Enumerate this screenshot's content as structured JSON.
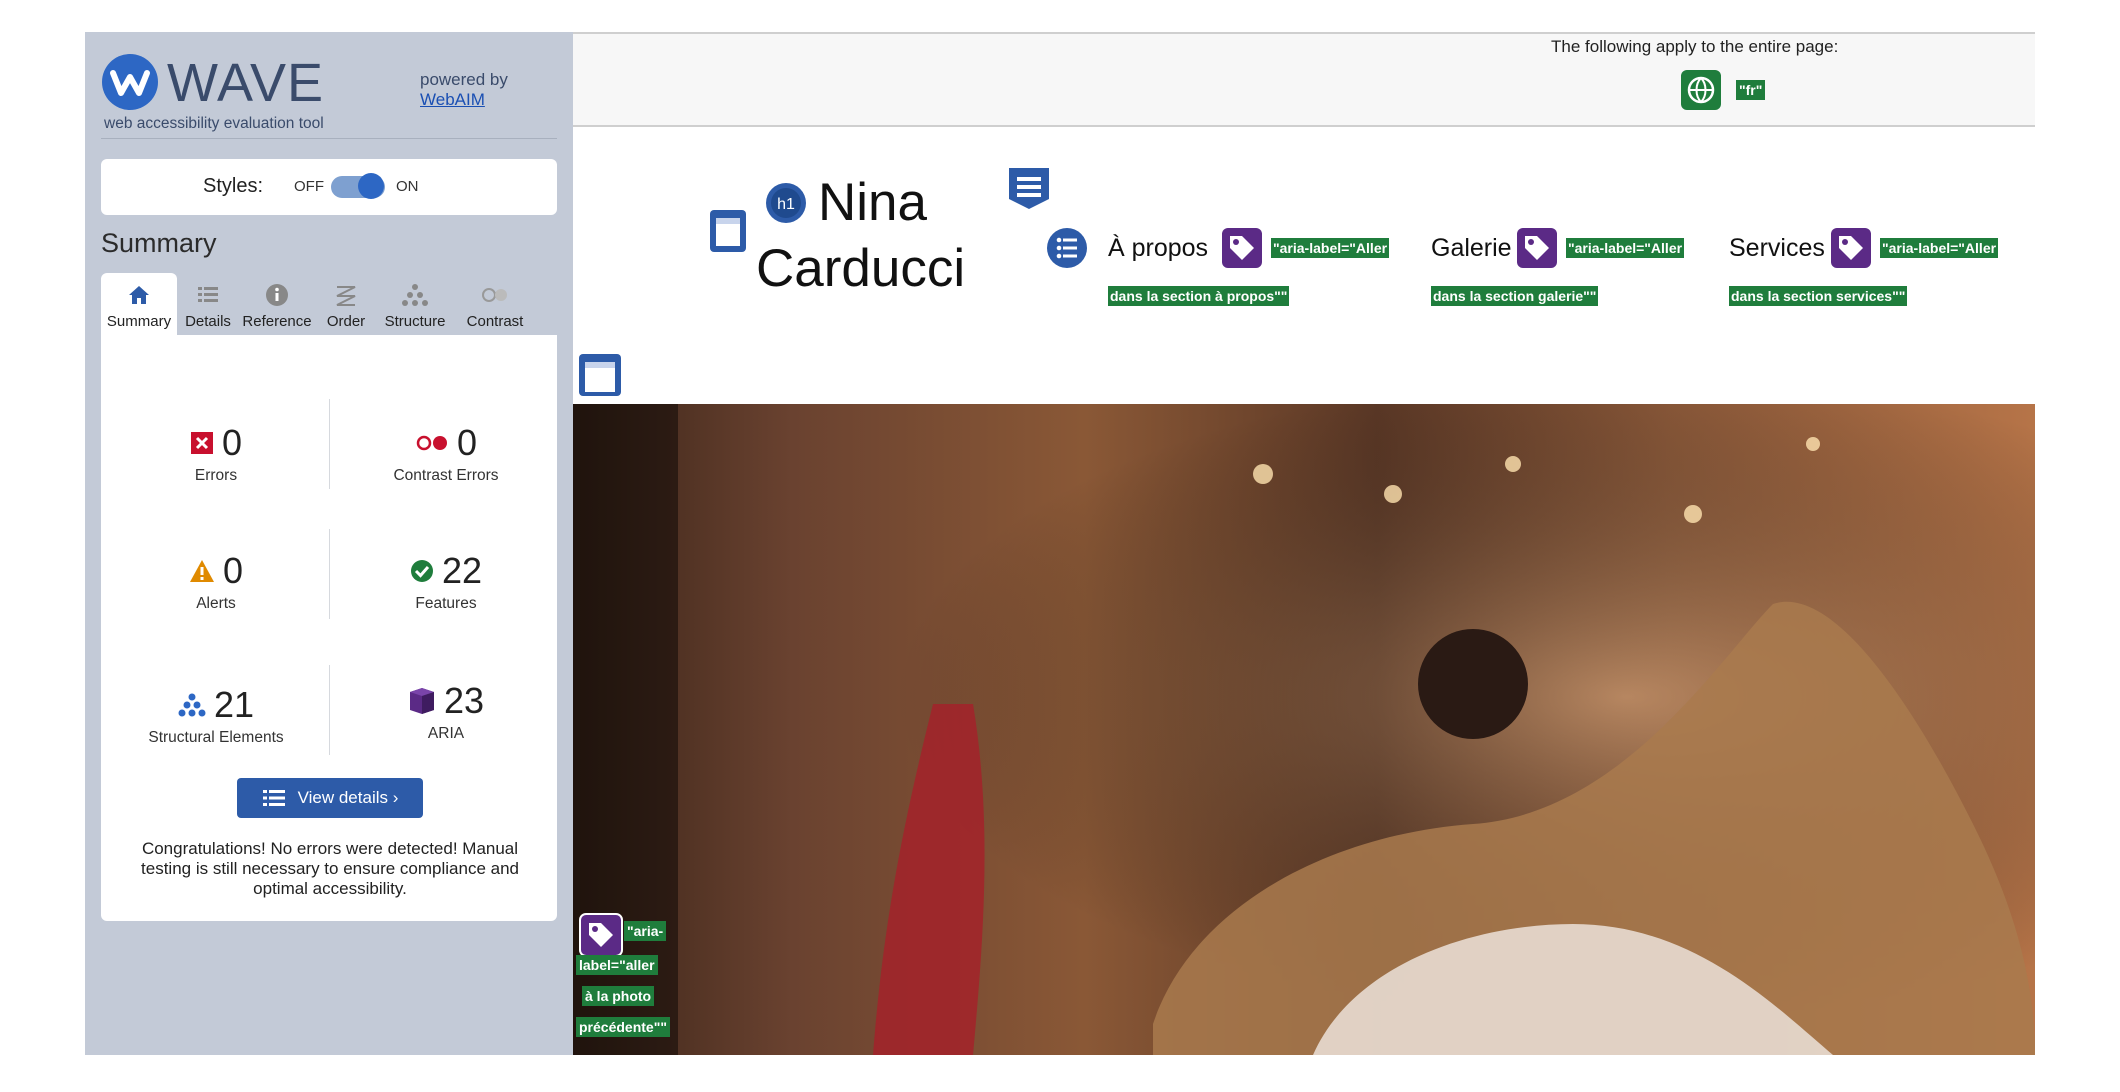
{
  "sidebar": {
    "brand": "WAVE",
    "tagline": "web accessibility evaluation tool",
    "powered_by": "powered by",
    "powered_by_link": "WebAIM",
    "styles_label": "Styles:",
    "styles_off": "OFF",
    "styles_on": "ON",
    "summary_heading": "Summary",
    "tabs": [
      {
        "label": "Summary",
        "icon": "home-icon",
        "active": true
      },
      {
        "label": "Details",
        "icon": "list-icon"
      },
      {
        "label": "Reference",
        "icon": "info-icon"
      },
      {
        "label": "Order",
        "icon": "order-icon"
      },
      {
        "label": "Structure",
        "icon": "structure-icon"
      },
      {
        "label": "Contrast",
        "icon": "contrast-icon"
      }
    ],
    "stats": {
      "errors": {
        "value": "0",
        "label": "Errors"
      },
      "contrast_errors": {
        "value": "0",
        "label": "Contrast Errors"
      },
      "alerts": {
        "value": "0",
        "label": "Alerts"
      },
      "features": {
        "value": "22",
        "label": "Features"
      },
      "structural": {
        "value": "21",
        "label": "Structural Elements"
      },
      "aria": {
        "value": "23",
        "label": "ARIA"
      }
    },
    "view_details": "View details ›",
    "congrats": "Congratulations! No errors were detected! Manual testing is still necessary to ensure compliance and optimal accessibility."
  },
  "page": {
    "banner_text": "The following apply to the entire page:",
    "lang_tag": "\"fr\"",
    "site_title_line1": "Nina",
    "site_title_line2": "Carducci",
    "nav": [
      {
        "label": "À propos",
        "aria_line1": "\"aria-label=\"Aller",
        "aria_line2": "dans la section à propos\"\""
      },
      {
        "label": "Galerie",
        "aria_line1": "\"aria-label=\"Aller",
        "aria_line2": "dans la section galerie\"\""
      },
      {
        "label": "Services",
        "aria_line1": "\"aria-label=\"Aller",
        "aria_line2": "dans la section services\"\""
      }
    ],
    "prev_aria": [
      "\"aria-",
      "label=\"aller",
      "à la photo",
      "précédente\"\""
    ],
    "h1_badge": "h1"
  },
  "colors": {
    "sidebar_bg": "#c3cad7",
    "accent_blue": "#2d5ba8",
    "aria_purple": "#5b2a86",
    "tag_green": "#1f7d3c"
  }
}
